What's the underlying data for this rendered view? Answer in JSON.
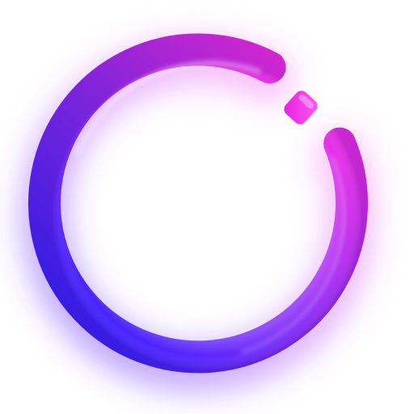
{
  "icon": {
    "name": "ring-logo-icon",
    "colors": {
      "magenta": "#ff2fe6",
      "violet": "#b02cf0",
      "blue": "#4a1fff",
      "glow": "#c84cff",
      "background": "#ffffff"
    }
  }
}
